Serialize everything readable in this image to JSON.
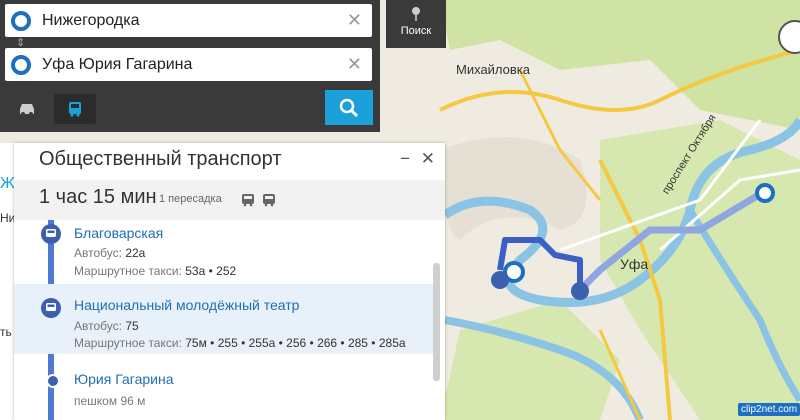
{
  "search": {
    "from": "Нижегородка",
    "to": "Уфа Юрия Гагарина",
    "clear_icon": "✕",
    "swap_icon": "swap-icon"
  },
  "modes": {
    "car": "car-icon",
    "bus": "bus-icon",
    "active": "bus"
  },
  "toolbar": {
    "search_label": "Поиск"
  },
  "map": {
    "labels": {
      "mikhailovka": "Михайловка",
      "ufa": "Уфа",
      "street": "проспект Октября"
    }
  },
  "panel": {
    "title": "Общественный транспорт",
    "duration": "1 час 15 мин",
    "transfers": "1 пересадка",
    "stops": [
      {
        "name": "Благоварская",
        "bus_label": "Автобус:",
        "bus": "22а",
        "taxi_label": "Маршрутное такси:",
        "taxi": "53а • 252"
      },
      {
        "name": "Национальный молодёжный театр",
        "bus_label": "Автобус:",
        "bus": "75",
        "taxi_label": "Маршрутное такси:",
        "taxi": "75м • 255 • 255а • 256 • 266 • 285 • 285а"
      },
      {
        "name": "Юрия Гагарина",
        "walk": "пешком 96 м"
      }
    ]
  },
  "side": {
    "t1": "Ж",
    "t2": "Ни",
    "t3": "ть"
  },
  "brand": "clip2net.com",
  "colors": {
    "route": "#3b5fc4",
    "accent": "#1ba0da",
    "dark": "#3a3a3a"
  }
}
